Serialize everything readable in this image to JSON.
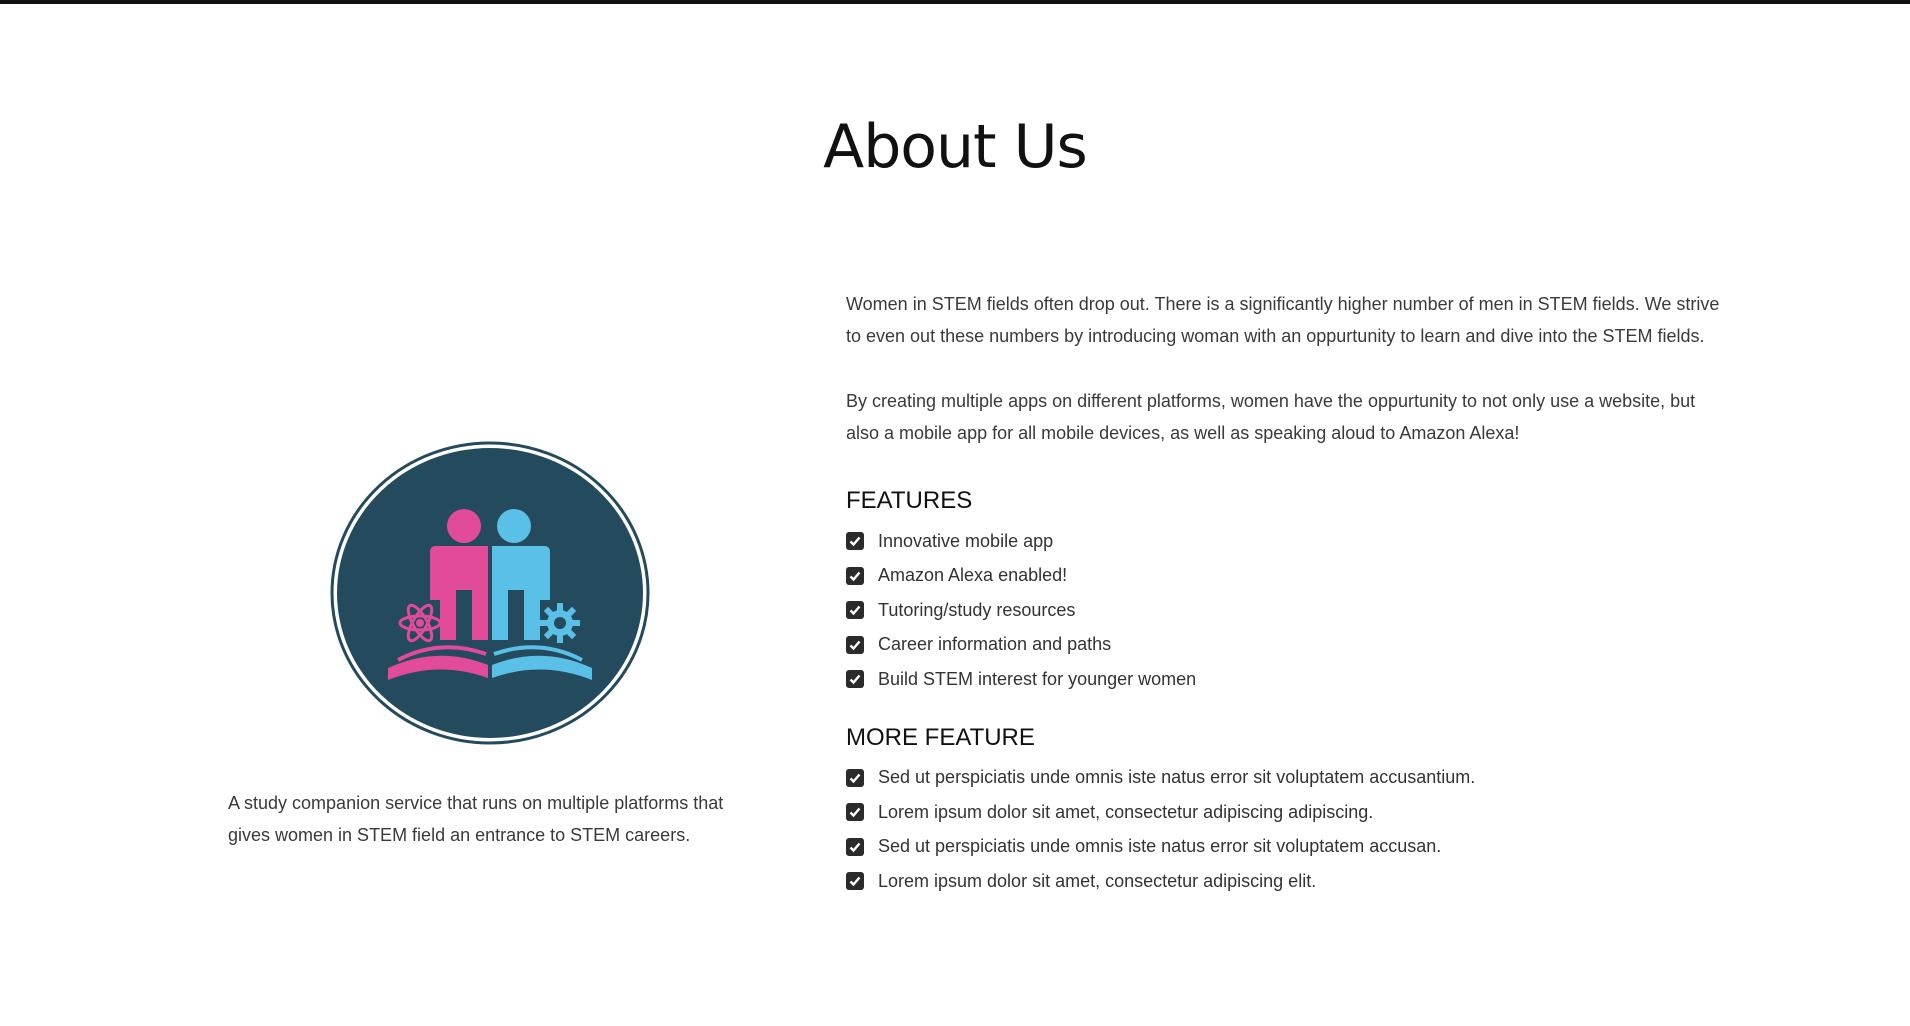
{
  "header": {
    "title": "About Us"
  },
  "left": {
    "logo_icon": "women-in-stem-logo-icon",
    "description": "A study companion service that runs on multiple platforms that gives women in STEM field an entrance to STEM careers.",
    "colors": {
      "logo_bg": "#244a5e",
      "pink": "#e24a9a",
      "blue": "#5bc0e8"
    }
  },
  "main": {
    "paragraphs": [
      "Women in STEM fields often drop out. There is a significantly higher number of men in STEM fields. We strive to even out these numbers by introducing woman with an oppurtunity to learn and dive into the STEM fields.",
      "By creating multiple apps on different platforms, women have the oppurtunity to not only use a website, but also a mobile app for all mobile devices, as well as speaking aloud to Amazon Alexa!"
    ],
    "features": {
      "heading": "FEATURES",
      "items": [
        "Innovative mobile app",
        "Amazon Alexa enabled!",
        "Tutoring/study resources",
        "Career information and paths",
        "Build STEM interest for younger women"
      ]
    },
    "more_features": {
      "heading": "MORE FEATURE",
      "items": [
        "Sed ut perspiciatis unde omnis iste natus error sit voluptatem accusantium.",
        "Lorem ipsum dolor sit amet, consectetur adipiscing adipiscing.",
        "Sed ut perspiciatis unde omnis iste natus error sit voluptatem accusan.",
        "Lorem ipsum dolor sit amet, consectetur adipiscing elit."
      ]
    }
  }
}
